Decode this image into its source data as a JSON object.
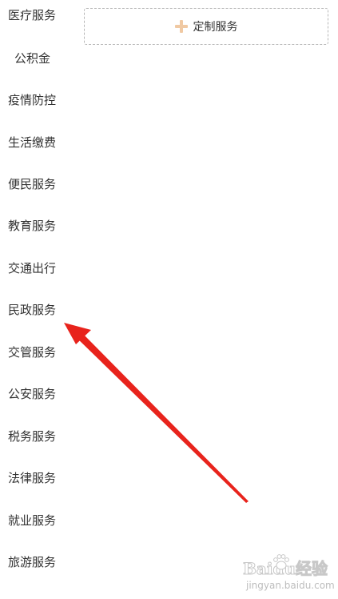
{
  "sidebar": {
    "items": [
      {
        "label": "医疗服务"
      },
      {
        "label": "公积金"
      },
      {
        "label": "疫情防控"
      },
      {
        "label": "生活缴费"
      },
      {
        "label": "便民服务"
      },
      {
        "label": "教育服务"
      },
      {
        "label": "交通出行"
      },
      {
        "label": "民政服务"
      },
      {
        "label": "交管服务"
      },
      {
        "label": "公安服务"
      },
      {
        "label": "税务服务"
      },
      {
        "label": "法律服务"
      },
      {
        "label": "就业服务"
      },
      {
        "label": "旅游服务"
      }
    ]
  },
  "main": {
    "custom_service_label": "定制服务",
    "custom_service_icon": "plus-icon"
  },
  "annotation": {
    "arrow_color": "#e8231c",
    "target": "民政服务"
  },
  "watermark": {
    "brand": "Baidu经验",
    "url": "jingyan.baidu.com"
  },
  "colors": {
    "text": "#333333",
    "plus_icon": "#f0c9a3",
    "dashed_border": "#b8b8b8"
  }
}
